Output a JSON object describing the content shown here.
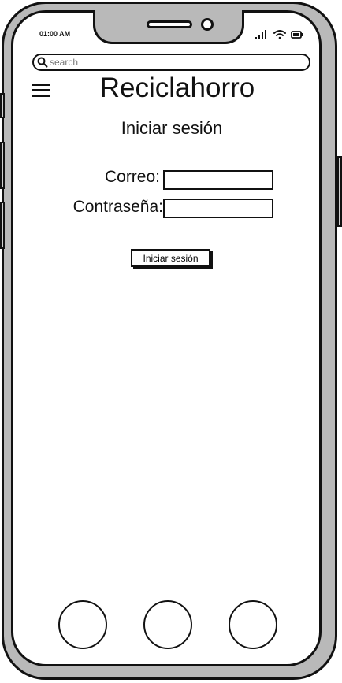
{
  "status_bar": {
    "time": "01:00 AM"
  },
  "search": {
    "placeholder": "search"
  },
  "app": {
    "title": "Reciclahorro"
  },
  "login": {
    "heading": "Iniciar sesión",
    "email_label": "Correo:",
    "email_value": "",
    "password_label": "Contraseña:",
    "password_value": "",
    "submit_label": "Iniciar sesión"
  },
  "icons": {
    "menu": "hamburger-menu-icon",
    "search": "search-icon",
    "signal": "signal-icon",
    "wifi": "wifi-icon",
    "battery": "battery-icon"
  }
}
